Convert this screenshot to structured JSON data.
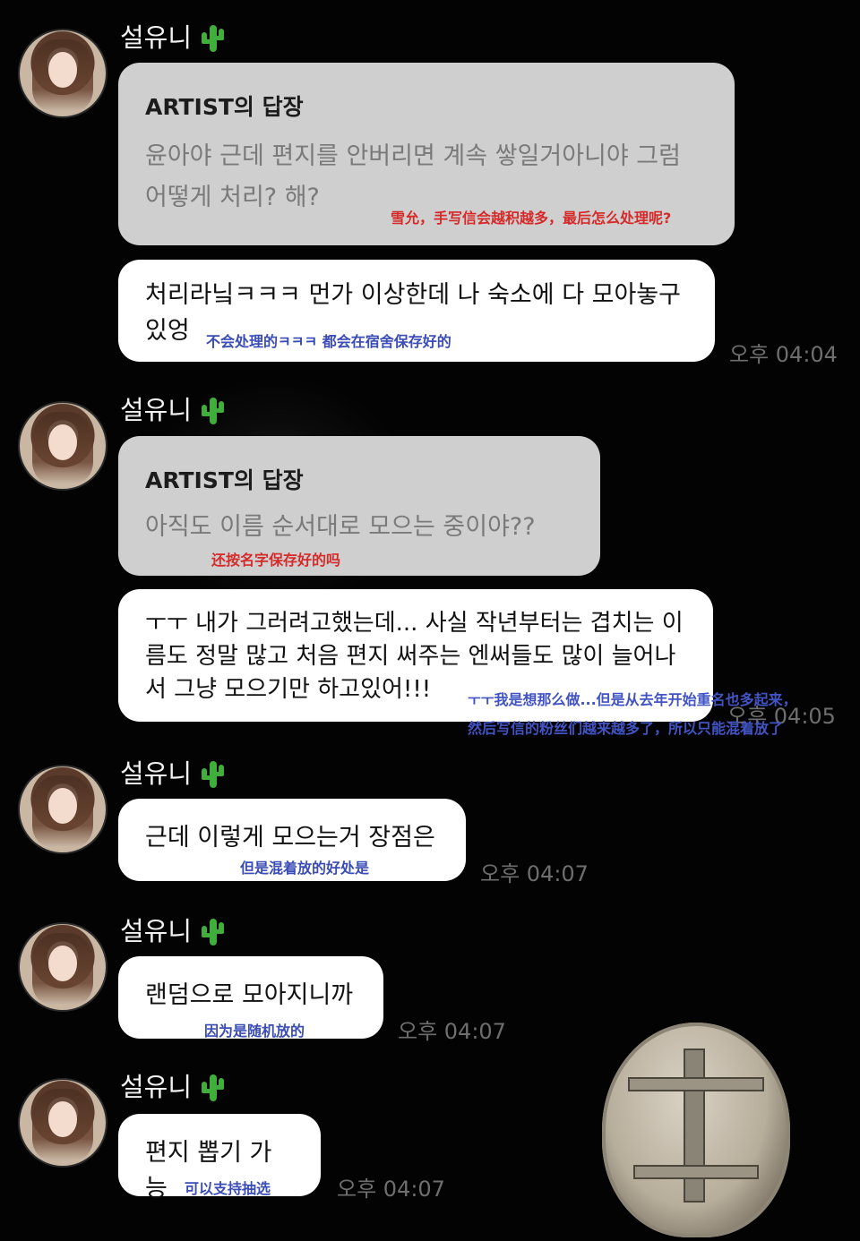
{
  "chat": {
    "sender_name": "설유니",
    "messages": [
      {
        "reply_title": "ARTIST의 답장",
        "reply_text": "윤아야 근데 편지를 안버리면 계속 쌓일거아니야 그럼 어떻게 처리? 해?",
        "reply_translation": "雪允，手写信会越积越多，最后怎么处理呢?",
        "text": "처리라닠ㅋㅋㅋ 먼가 이상한데 나 숙소에 다 모아놓구 있엉",
        "translation": "不会处理的ㅋㅋㅋ 都会在宿舍保存好的",
        "time": "오후 04:04"
      },
      {
        "reply_title": "ARTIST의 답장",
        "reply_text": "아직도 이름 순서대로 모으는 중이야??",
        "reply_translation": "还按名字保存好的吗",
        "text": "ㅜㅜ 내가 그러려고했는데... 사실 작년부터는 겹치는 이름도 정말 많고 처음 편지 써주는 엔써들도 많이 늘어나서 그냥 모으기만 하고있어!!!",
        "translation": "ㅜㅜ我是想那么做...但是从去年开始重名也多起来，然后写信的粉丝们越来越多了，所以只能混着放了",
        "time": "오후 04:05"
      },
      {
        "text": "근데 이렇게 모으는거 장점은",
        "translation": "但是混着放的好处是",
        "time": "오후 04:07"
      },
      {
        "text": "랜덤으로 모아지니까",
        "translation": "因为是随机放的",
        "time": "오후 04:07"
      },
      {
        "text": "편지 뽑기 가능",
        "translation": "可以支持抽选",
        "time": "오후 04:07"
      }
    ]
  },
  "icons": {
    "name_badge": "cactus-icon",
    "avatar": "profile-avatar"
  },
  "colors": {
    "background": "#030303",
    "bubble": "#ffffff",
    "reply_bubble": "#cfcfcf",
    "translation_red": "#d62a2a",
    "translation_blue": "#3a4cb5",
    "timestamp": "#6e6e6e"
  }
}
